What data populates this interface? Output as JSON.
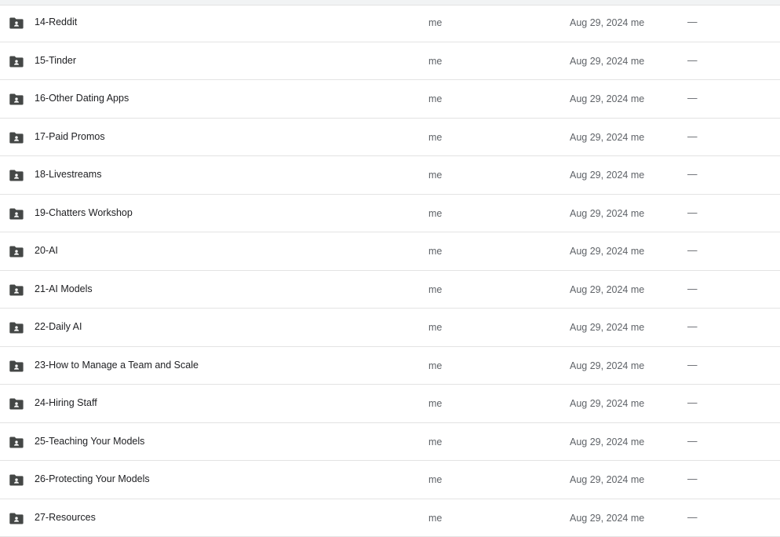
{
  "rows": [
    {
      "name": "14-Reddit",
      "owner": "me",
      "modified": "Aug 29, 2024 me",
      "size": "—",
      "icon": "shared-folder-icon"
    },
    {
      "name": "15-Tinder",
      "owner": "me",
      "modified": "Aug 29, 2024 me",
      "size": "—",
      "icon": "shared-folder-icon"
    },
    {
      "name": "16-Other Dating Apps",
      "owner": "me",
      "modified": "Aug 29, 2024 me",
      "size": "—",
      "icon": "shared-folder-icon"
    },
    {
      "name": "17-Paid Promos",
      "owner": "me",
      "modified": "Aug 29, 2024 me",
      "size": "—",
      "icon": "shared-folder-icon"
    },
    {
      "name": "18-Livestreams",
      "owner": "me",
      "modified": "Aug 29, 2024 me",
      "size": "—",
      "icon": "shared-folder-icon"
    },
    {
      "name": "19-Chatters Workshop",
      "owner": "me",
      "modified": "Aug 29, 2024 me",
      "size": "—",
      "icon": "shared-folder-icon"
    },
    {
      "name": "20-AI",
      "owner": "me",
      "modified": "Aug 29, 2024 me",
      "size": "—",
      "icon": "shared-folder-icon"
    },
    {
      "name": "21-AI Models",
      "owner": "me",
      "modified": "Aug 29, 2024 me",
      "size": "—",
      "icon": "shared-folder-icon"
    },
    {
      "name": "22-Daily AI",
      "owner": "me",
      "modified": "Aug 29, 2024 me",
      "size": "—",
      "icon": "shared-folder-icon"
    },
    {
      "name": "23-How to Manage a Team and Scale",
      "owner": "me",
      "modified": "Aug 29, 2024 me",
      "size": "—",
      "icon": "shared-folder-icon"
    },
    {
      "name": "24-Hiring Staff",
      "owner": "me",
      "modified": "Aug 29, 2024 me",
      "size": "—",
      "icon": "shared-folder-icon"
    },
    {
      "name": "25-Teaching Your Models",
      "owner": "me",
      "modified": "Aug 29, 2024 me",
      "size": "—",
      "icon": "shared-folder-icon"
    },
    {
      "name": "26-Protecting Your Models",
      "owner": "me",
      "modified": "Aug 29, 2024 me",
      "size": "—",
      "icon": "shared-folder-icon"
    },
    {
      "name": "27-Resources",
      "owner": "me",
      "modified": "Aug 29, 2024 me",
      "size": "—",
      "icon": "shared-folder-icon"
    }
  ],
  "colors": {
    "icon": "#444746",
    "divider": "#e3e3e3",
    "name_text": "#202124",
    "secondary_text": "#5f6368"
  }
}
